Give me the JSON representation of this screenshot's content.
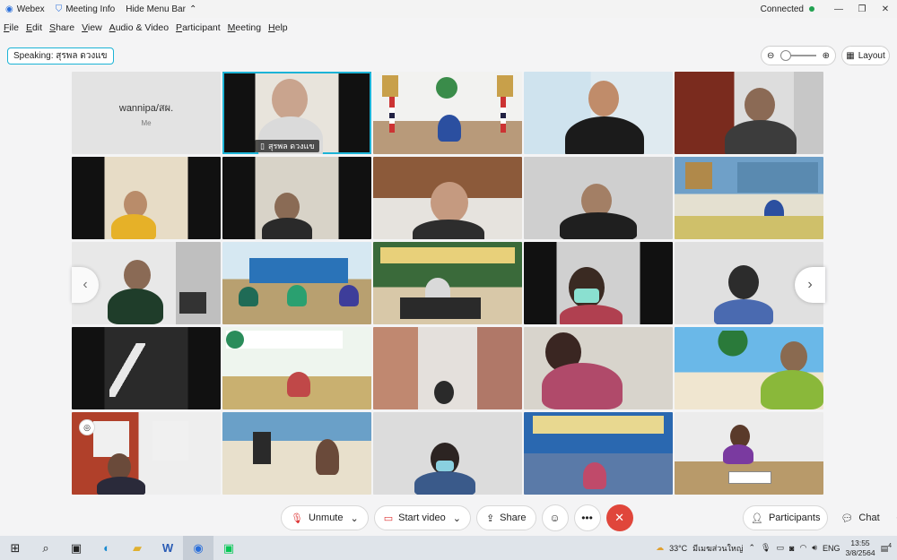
{
  "titlebar": {
    "app": "Webex",
    "meeting_info": "Meeting Info",
    "hide_menu": "Hide Menu Bar",
    "status": "Connected"
  },
  "menu": [
    "File",
    "Edit",
    "Share",
    "View",
    "Audio & Video",
    "Participant",
    "Meeting",
    "Help"
  ],
  "speaking": "Speaking: สุรพล ดวงแข",
  "layout_label": "Layout",
  "self_tile": {
    "name": "wannipa/สผ.",
    "sub": "Me"
  },
  "active_tile_name": "สุรพล ดวงแข",
  "controls": {
    "unmute": "Unmute",
    "start_video": "Start video",
    "share": "Share",
    "participants": "Participants",
    "chat": "Chat"
  },
  "taskbar": {
    "weather": "33°C",
    "weather_desc": "มีเมฆส่วนใหญ่",
    "lang": "ENG",
    "time": "13:55",
    "date": "3/8/2564",
    "notif_count": "4"
  },
  "colors": {
    "accent": "#1cb3d6",
    "end_call": "#e0463b",
    "connected": "#21a150"
  }
}
